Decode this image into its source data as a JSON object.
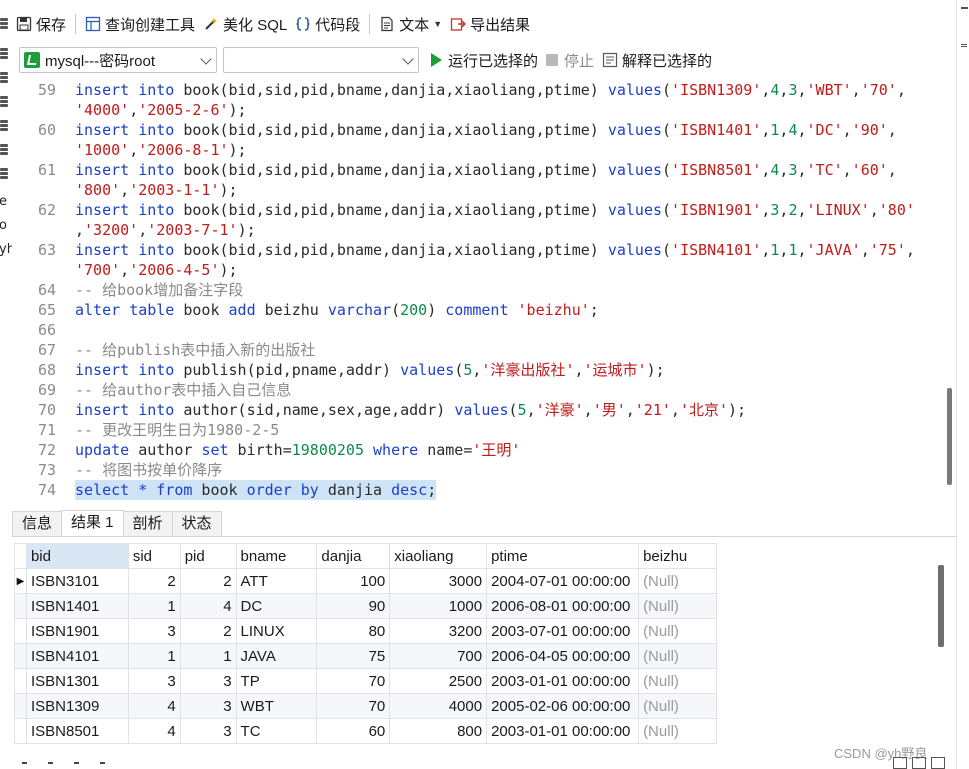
{
  "toolbar": {
    "save_label": "保存",
    "query_builder_label": "查询创建工具",
    "beautify_label": "美化 SQL",
    "snippet_label": "代码段",
    "text_label": "文本",
    "export_label": "导出结果"
  },
  "query_bar": {
    "connection": "mysql---密码root",
    "database": "",
    "run_selected_label": "运行已选择的",
    "stop_label": "停止",
    "explain_selected_label": "解释已选择的"
  },
  "left_fragment": {
    "line1": "e",
    "line2": "o",
    "line3": "yh"
  },
  "editor": {
    "lines": [
      {
        "n": "59",
        "t": "insert into book(bid,sid,pid,bname,danjia,xiaoliang,ptime) values('ISBN1309',4,3,'WBT','70',"
      },
      {
        "n": "",
        "t": "'4000','2005-2-6');"
      },
      {
        "n": "60",
        "t": "insert into book(bid,sid,pid,bname,danjia,xiaoliang,ptime) values('ISBN1401',1,4,'DC','90',"
      },
      {
        "n": "",
        "t": "'1000','2006-8-1');"
      },
      {
        "n": "61",
        "t": "insert into book(bid,sid,pid,bname,danjia,xiaoliang,ptime) values('ISBN8501',4,3,'TC','60',"
      },
      {
        "n": "",
        "t": "'800','2003-1-1');"
      },
      {
        "n": "62",
        "t": "insert into book(bid,sid,pid,bname,danjia,xiaoliang,ptime) values('ISBN1901',3,2,'LINUX','80'"
      },
      {
        "n": "",
        "t": ",'3200','2003-7-1');"
      },
      {
        "n": "63",
        "t": "insert into book(bid,sid,pid,bname,danjia,xiaoliang,ptime) values('ISBN4101',1,1,'JAVA','75',"
      },
      {
        "n": "",
        "t": "'700','2006-4-5');"
      },
      {
        "n": "64",
        "t": "-- 给book增加备注字段"
      },
      {
        "n": "65",
        "t": "alter table book add beizhu varchar(200) comment 'beizhu';"
      },
      {
        "n": "66",
        "t": ""
      },
      {
        "n": "67",
        "t": "-- 给publish表中插入新的出版社"
      },
      {
        "n": "68",
        "t": "insert into publish(pid,pname,addr) values(5,'洋豪出版社','运城市');"
      },
      {
        "n": "69",
        "t": "-- 给author表中插入自己信息"
      },
      {
        "n": "70",
        "t": "insert into author(sid,name,sex,age,addr) values(5,'洋豪','男','21','北京');"
      },
      {
        "n": "71",
        "t": "-- 更改王明生日为1980-2-5"
      },
      {
        "n": "72",
        "t": "update author set birth=19800205 where name='王明'"
      },
      {
        "n": "73",
        "t": "-- 将图书按单价降序"
      },
      {
        "n": "74",
        "t": "select * from book order by danjia desc;"
      }
    ]
  },
  "result_tabs": [
    "信息",
    "结果 1",
    "剖析",
    "状态"
  ],
  "grid": {
    "columns": [
      "bid",
      "sid",
      "pid",
      "bname",
      "danjia",
      "xiaoliang",
      "ptime",
      "beizhu"
    ],
    "rows": [
      [
        "ISBN3101",
        "2",
        "2",
        "ATT",
        "100",
        "3000",
        "2004-07-01 00:00:00",
        "(Null)"
      ],
      [
        "ISBN1401",
        "1",
        "4",
        "DC",
        "90",
        "1000",
        "2006-08-01 00:00:00",
        "(Null)"
      ],
      [
        "ISBN1901",
        "3",
        "2",
        "LINUX",
        "80",
        "3200",
        "2003-07-01 00:00:00",
        "(Null)"
      ],
      [
        "ISBN4101",
        "1",
        "1",
        "JAVA",
        "75",
        "700",
        "2006-04-05 00:00:00",
        "(Null)"
      ],
      [
        "ISBN1301",
        "3",
        "3",
        "TP",
        "70",
        "2500",
        "2003-01-01 00:00:00",
        "(Null)"
      ],
      [
        "ISBN1309",
        "4",
        "3",
        "WBT",
        "70",
        "4000",
        "2005-02-06 00:00:00",
        "(Null)"
      ],
      [
        "ISBN8501",
        "4",
        "3",
        "TC",
        "60",
        "800",
        "2003-01-01 00:00:00",
        "(Null)"
      ]
    ]
  },
  "watermark": "CSDN @yh野良",
  "colors": {
    "keyword": "#1a3fcc",
    "string": "#c11b1b",
    "number": "#0b8a4a",
    "comment": "#8a8a8a",
    "selection": "#cfe3f7"
  }
}
